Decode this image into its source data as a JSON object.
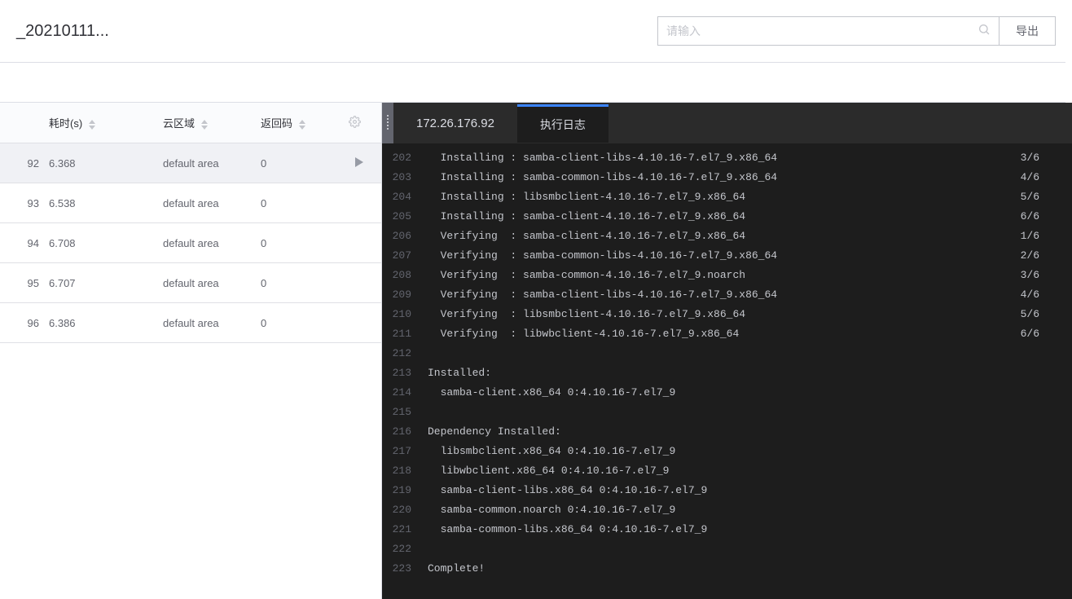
{
  "header": {
    "title": "_20210111...",
    "search_placeholder": "请输入",
    "export_label": "导出"
  },
  "table": {
    "columns": {
      "time": "耗时(s)",
      "area": "云区域",
      "code": "返回码"
    },
    "rows": [
      {
        "id": "92",
        "time": "6.368",
        "area": "default area",
        "code": "0",
        "selected": true
      },
      {
        "id": "93",
        "time": "6.538",
        "area": "default area",
        "code": "0",
        "selected": false
      },
      {
        "id": "94",
        "time": "6.708",
        "area": "default area",
        "code": "0",
        "selected": false
      },
      {
        "id": "95",
        "time": "6.707",
        "area": "default area",
        "code": "0",
        "selected": false
      },
      {
        "id": "96",
        "time": "6.386",
        "area": "default area",
        "code": "0",
        "selected": false
      }
    ]
  },
  "log_panel": {
    "ip": "172.26.176.92",
    "tab_label": "执行日志",
    "lines": [
      {
        "n": "202",
        "t": "  Installing : samba-client-libs-4.10.16-7.el7_9.x86_64",
        "p": "3/6"
      },
      {
        "n": "203",
        "t": "  Installing : samba-common-libs-4.10.16-7.el7_9.x86_64",
        "p": "4/6"
      },
      {
        "n": "204",
        "t": "  Installing : libsmbclient-4.10.16-7.el7_9.x86_64",
        "p": "5/6"
      },
      {
        "n": "205",
        "t": "  Installing : samba-client-4.10.16-7.el7_9.x86_64",
        "p": "6/6"
      },
      {
        "n": "206",
        "t": "  Verifying  : samba-client-4.10.16-7.el7_9.x86_64",
        "p": "1/6"
      },
      {
        "n": "207",
        "t": "  Verifying  : samba-common-libs-4.10.16-7.el7_9.x86_64",
        "p": "2/6"
      },
      {
        "n": "208",
        "t": "  Verifying  : samba-common-4.10.16-7.el7_9.noarch",
        "p": "3/6"
      },
      {
        "n": "209",
        "t": "  Verifying  : samba-client-libs-4.10.16-7.el7_9.x86_64",
        "p": "4/6"
      },
      {
        "n": "210",
        "t": "  Verifying  : libsmbclient-4.10.16-7.el7_9.x86_64",
        "p": "5/6"
      },
      {
        "n": "211",
        "t": "  Verifying  : libwbclient-4.10.16-7.el7_9.x86_64",
        "p": "6/6"
      },
      {
        "n": "212",
        "t": "",
        "p": ""
      },
      {
        "n": "213",
        "t": "Installed:",
        "p": ""
      },
      {
        "n": "214",
        "t": "  samba-client.x86_64 0:4.10.16-7.el7_9",
        "p": ""
      },
      {
        "n": "215",
        "t": "",
        "p": ""
      },
      {
        "n": "216",
        "t": "Dependency Installed:",
        "p": ""
      },
      {
        "n": "217",
        "t": "  libsmbclient.x86_64 0:4.10.16-7.el7_9",
        "p": ""
      },
      {
        "n": "218",
        "t": "  libwbclient.x86_64 0:4.10.16-7.el7_9",
        "p": ""
      },
      {
        "n": "219",
        "t": "  samba-client-libs.x86_64 0:4.10.16-7.el7_9",
        "p": ""
      },
      {
        "n": "220",
        "t": "  samba-common.noarch 0:4.10.16-7.el7_9",
        "p": ""
      },
      {
        "n": "221",
        "t": "  samba-common-libs.x86_64 0:4.10.16-7.el7_9",
        "p": ""
      },
      {
        "n": "222",
        "t": "",
        "p": ""
      },
      {
        "n": "223",
        "t": "Complete!",
        "p": ""
      }
    ]
  }
}
